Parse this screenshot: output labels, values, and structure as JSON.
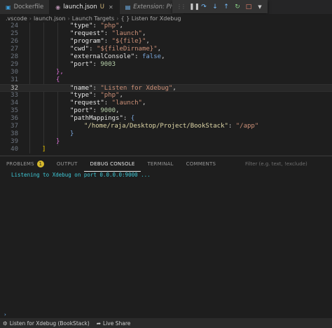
{
  "tabs": [
    {
      "label": "Dockerfile",
      "icon": "docker-icon",
      "active": false
    },
    {
      "label": "launch.json",
      "modified_marker": "U",
      "icon": "json-icon",
      "active": true
    },
    {
      "label": "Extension: PHP",
      "icon": "extension-icon",
      "active": false
    }
  ],
  "breadcrumb": [
    ".vscode",
    "launch.json",
    "Launch Targets",
    "{ } Listen for Xdebug"
  ],
  "editor": {
    "current_line": "32",
    "lines": [
      {
        "num": "24"
      },
      {
        "num": "25"
      },
      {
        "num": "26"
      },
      {
        "num": "27"
      },
      {
        "num": "28"
      },
      {
        "num": "29"
      },
      {
        "num": "30"
      },
      {
        "num": "31"
      },
      {
        "num": "32"
      },
      {
        "num": "33"
      },
      {
        "num": "34"
      },
      {
        "num": "35"
      },
      {
        "num": "36"
      },
      {
        "num": "37"
      },
      {
        "num": "38"
      },
      {
        "num": "39"
      },
      {
        "num": "40"
      }
    ],
    "code": {
      "l24_key": "\"type\"",
      "l24_val": "\"php\"",
      "l25_key": "\"request\"",
      "l25_val": "\"launch\"",
      "l26_key": "\"program\"",
      "l26_val": "\"${file}\"",
      "l27_key": "\"cwd\"",
      "l27_val": "\"${fileDirname}\"",
      "l28_key": "\"externalConsole\"",
      "l28_val": "false",
      "l29_key": "\"port\"",
      "l29_val": "9003",
      "l30": "},",
      "l31": "{",
      "l32_key": "\"name\"",
      "l32_val": "\"Listen for Xdebug\"",
      "l33_key": "\"type\"",
      "l33_val": "\"php\"",
      "l34_key": "\"request\"",
      "l34_val": "\"launch\"",
      "l35_key": "\"port\"",
      "l35_val": "9000",
      "l36_key": "\"pathMappings\"",
      "l36_val": "{",
      "l37_key": "\"/home/raja/Desktop/Project/BookStack\"",
      "l37_val": "\"/app\"",
      "l38": "}",
      "l39": "}",
      "l40": "]"
    }
  },
  "panel": {
    "tabs": [
      "PROBLEMS",
      "OUTPUT",
      "DEBUG CONSOLE",
      "TERMINAL",
      "COMMENTS"
    ],
    "problems_count": "1",
    "active_tab": "DEBUG CONSOLE",
    "filter_placeholder": "Filter (e.g. text, !exclude)",
    "console_lines": [
      "Listening to Xdebug on port 0.0.0.0:9000 ..."
    ]
  },
  "statusbar": {
    "debug_config": "Listen for Xdebug (BookStack)",
    "live_share": "Live Share"
  },
  "colors": {
    "editor_bg": "#1e1e1e",
    "console_text": "#3ec8d6",
    "badge": "#d7ba2d"
  }
}
